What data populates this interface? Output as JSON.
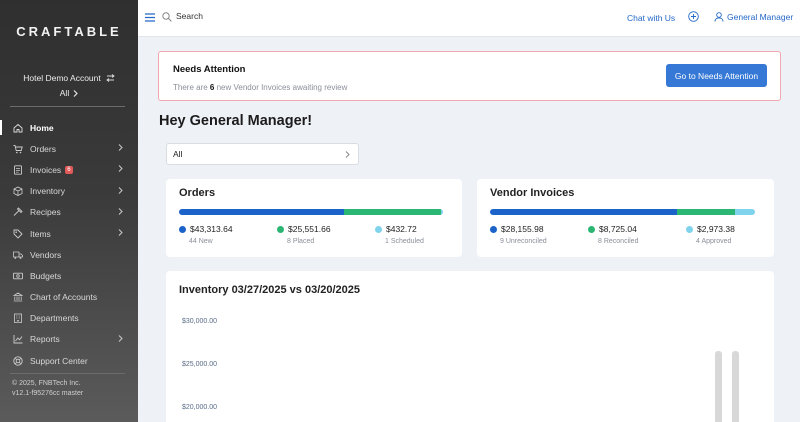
{
  "sidebar": {
    "logo": "CRAFTABLE",
    "account_name": "Hotel Demo Account",
    "account_scope": "All",
    "items": [
      {
        "label": "Home",
        "icon": "home-icon",
        "active": true,
        "chevron": false
      },
      {
        "label": "Orders",
        "icon": "cart-icon",
        "chevron": true
      },
      {
        "label": "Invoices",
        "icon": "invoice-icon",
        "chevron": true,
        "badge": "6"
      },
      {
        "label": "Inventory",
        "icon": "box-icon",
        "chevron": true
      },
      {
        "label": "Recipes",
        "icon": "recipe-icon",
        "chevron": true
      },
      {
        "label": "Items",
        "icon": "tag-icon",
        "chevron": true
      },
      {
        "label": "Vendors",
        "icon": "truck-icon",
        "chevron": false
      },
      {
        "label": "Budgets",
        "icon": "money-icon",
        "chevron": false
      },
      {
        "label": "Chart of Accounts",
        "icon": "bank-icon",
        "chevron": false
      },
      {
        "label": "Departments",
        "icon": "building-icon",
        "chevron": false
      },
      {
        "label": "Reports",
        "icon": "chart-icon",
        "chevron": true
      },
      {
        "label": "Support Center",
        "icon": "lifebuoy-icon",
        "chevron": false
      }
    ],
    "footer_copyright": "© 2025, FNBTech Inc.",
    "footer_version": "v12.1-f95276cc master"
  },
  "topbar": {
    "search_placeholder": "Search",
    "chat_label": "Chat with Us",
    "user_label": "General Manager"
  },
  "attention": {
    "title": "Needs Attention",
    "text_prefix": "There are",
    "count": "6",
    "text_suffix": "new Vendor Invoices awaiting review",
    "button_label": "Go to Needs Attention"
  },
  "greeting": "Hey General Manager!",
  "filter": {
    "selected": "All"
  },
  "orders": {
    "title": "Orders",
    "stats": [
      {
        "amount": "$43,313.64",
        "label": "44 New",
        "color": "#1c63c9"
      },
      {
        "amount": "$25,551.66",
        "label": "8 Placed",
        "color": "#2bb673"
      },
      {
        "amount": "$432.72",
        "label": "1 Scheduled",
        "color": "#7fd3ec"
      }
    ],
    "fractions": [
      0.625,
      0.369,
      0.006
    ]
  },
  "vendor_invoices": {
    "title": "Vendor Invoices",
    "stats": [
      {
        "amount": "$28,155.98",
        "label": "9 Unreconciled",
        "color": "#1c63c9"
      },
      {
        "amount": "$8,725.04",
        "label": "8 Reconciled",
        "color": "#2bb673"
      },
      {
        "amount": "$2,973.38",
        "label": "4 Approved",
        "color": "#7fd3ec"
      }
    ],
    "fractions": [
      0.707,
      0.219,
      0.074
    ]
  },
  "inventory": {
    "title": "Inventory 03/27/2025 vs 03/20/2025",
    "y_ticks": [
      "$30,000.00",
      "$25,000.00",
      "$20,000.00"
    ]
  }
}
